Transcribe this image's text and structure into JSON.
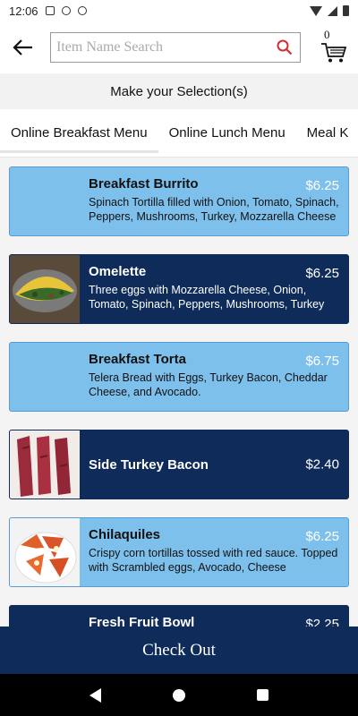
{
  "status_bar": {
    "time": "12:06"
  },
  "top_bar": {
    "search_placeholder": "Item Name Search",
    "cart_count": "0"
  },
  "selection_header": "Make your Selection(s)",
  "tabs": [
    {
      "label": "Online Breakfast Menu",
      "active": true
    },
    {
      "label": "Online Lunch Menu",
      "active": false
    },
    {
      "label": "Meal K",
      "active": false
    }
  ],
  "menu_items": [
    {
      "title": "Breakfast Burrito",
      "price": "$6.25",
      "description": "Spinach Tortilla filled with Onion, Tomato, Spinach, Peppers, Mushrooms, Turkey, Mozzarella Cheese",
      "theme": "light",
      "image": "none"
    },
    {
      "title": "Omelette",
      "price": "$6.25",
      "description": "Three eggs with Mozzarella Cheese, Onion, Tomato, Spinach, Peppers, Mushrooms, Turkey",
      "theme": "dark",
      "image": "omelette"
    },
    {
      "title": "Breakfast Torta",
      "price": "$6.75",
      "description": "Telera Bread with Eggs, Turkey Bacon, Cheddar Cheese, and Avocado.",
      "theme": "light",
      "image": "none"
    },
    {
      "title": "Side Turkey Bacon",
      "price": "$2.40",
      "description": "",
      "theme": "dark",
      "image": "bacon"
    },
    {
      "title": "Chilaquiles",
      "price": "$6.25",
      "description": "Crispy corn tortillas tossed with red sauce. Topped with Scrambled eggs, Avocado, Cheese",
      "theme": "light",
      "image": "chilaquiles"
    },
    {
      "title": "Fresh Fruit Bowl",
      "price": "$2.25",
      "description": "",
      "theme": "dark",
      "image": "none"
    }
  ],
  "checkout_label": "Check Out",
  "colors": {
    "navy": "#0e2b5a",
    "light_blue": "#7ec0ec",
    "search_accent": "#d32f2f"
  }
}
